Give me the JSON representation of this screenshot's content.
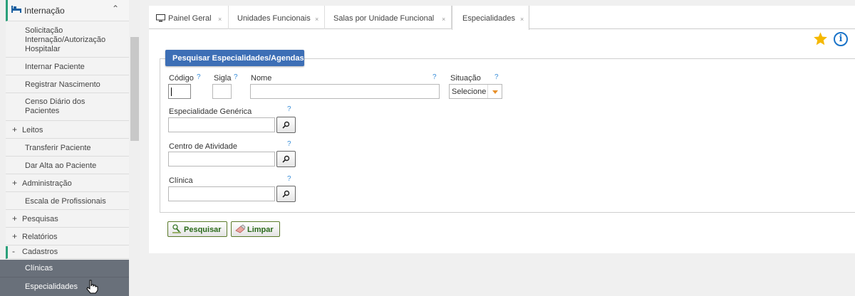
{
  "sidebar": {
    "section_title": "Internação",
    "items": [
      {
        "label": "Solicitação Internação/Autorização Hospitalar"
      },
      {
        "label": "Internar Paciente"
      },
      {
        "label": "Registrar Nascimento"
      },
      {
        "label": "Censo Diário dos Pacientes"
      },
      {
        "label": "Leitos",
        "expander": "+"
      },
      {
        "label": "Transferir Paciente"
      },
      {
        "label": "Dar Alta ao Paciente"
      },
      {
        "label": "Administração",
        "expander": "+"
      },
      {
        "label": "Escala de Profissionais"
      },
      {
        "label": "Pesquisas",
        "expander": "+"
      },
      {
        "label": "Relatórios",
        "expander": "+"
      },
      {
        "label": "Cadastros",
        "expander": "-"
      }
    ],
    "subitems": [
      {
        "label": "Clínicas"
      },
      {
        "label": "Especialidades"
      }
    ]
  },
  "tabs": [
    {
      "label": "Painel Geral",
      "close": "×"
    },
    {
      "label": "Unidades Funcionais",
      "close": "×"
    },
    {
      "label": "Salas por Unidade Funcional",
      "close": "×"
    },
    {
      "label": "Especialidades",
      "close": "×"
    }
  ],
  "form": {
    "legend": "Pesquisar Especialidades/Agendas",
    "help_mark": "?",
    "codigo_label": "Código",
    "sigla_label": "Sigla",
    "nome_label": "Nome",
    "situacao_label": "Situação",
    "situacao_value": "Selecione",
    "esp_generica_label": "Especialidade Genérica",
    "centro_atividade_label": "Centro de Atividade",
    "clinica_label": "Clínica"
  },
  "buttons": {
    "pesquisar": "Pesquisar",
    "limpar": "Limpar"
  },
  "colors": {
    "accent": "#3d6fb6",
    "sidebar_active": "#69707a",
    "green_marker": "#2aa07a",
    "star": "#f5b800",
    "info": "#1a73c8"
  },
  "icons": [
    "bed-icon",
    "chevron-up-icon",
    "monitor-icon",
    "star-icon",
    "info-icon",
    "search-icon",
    "broom-icon",
    "hand-cursor-icon"
  ]
}
